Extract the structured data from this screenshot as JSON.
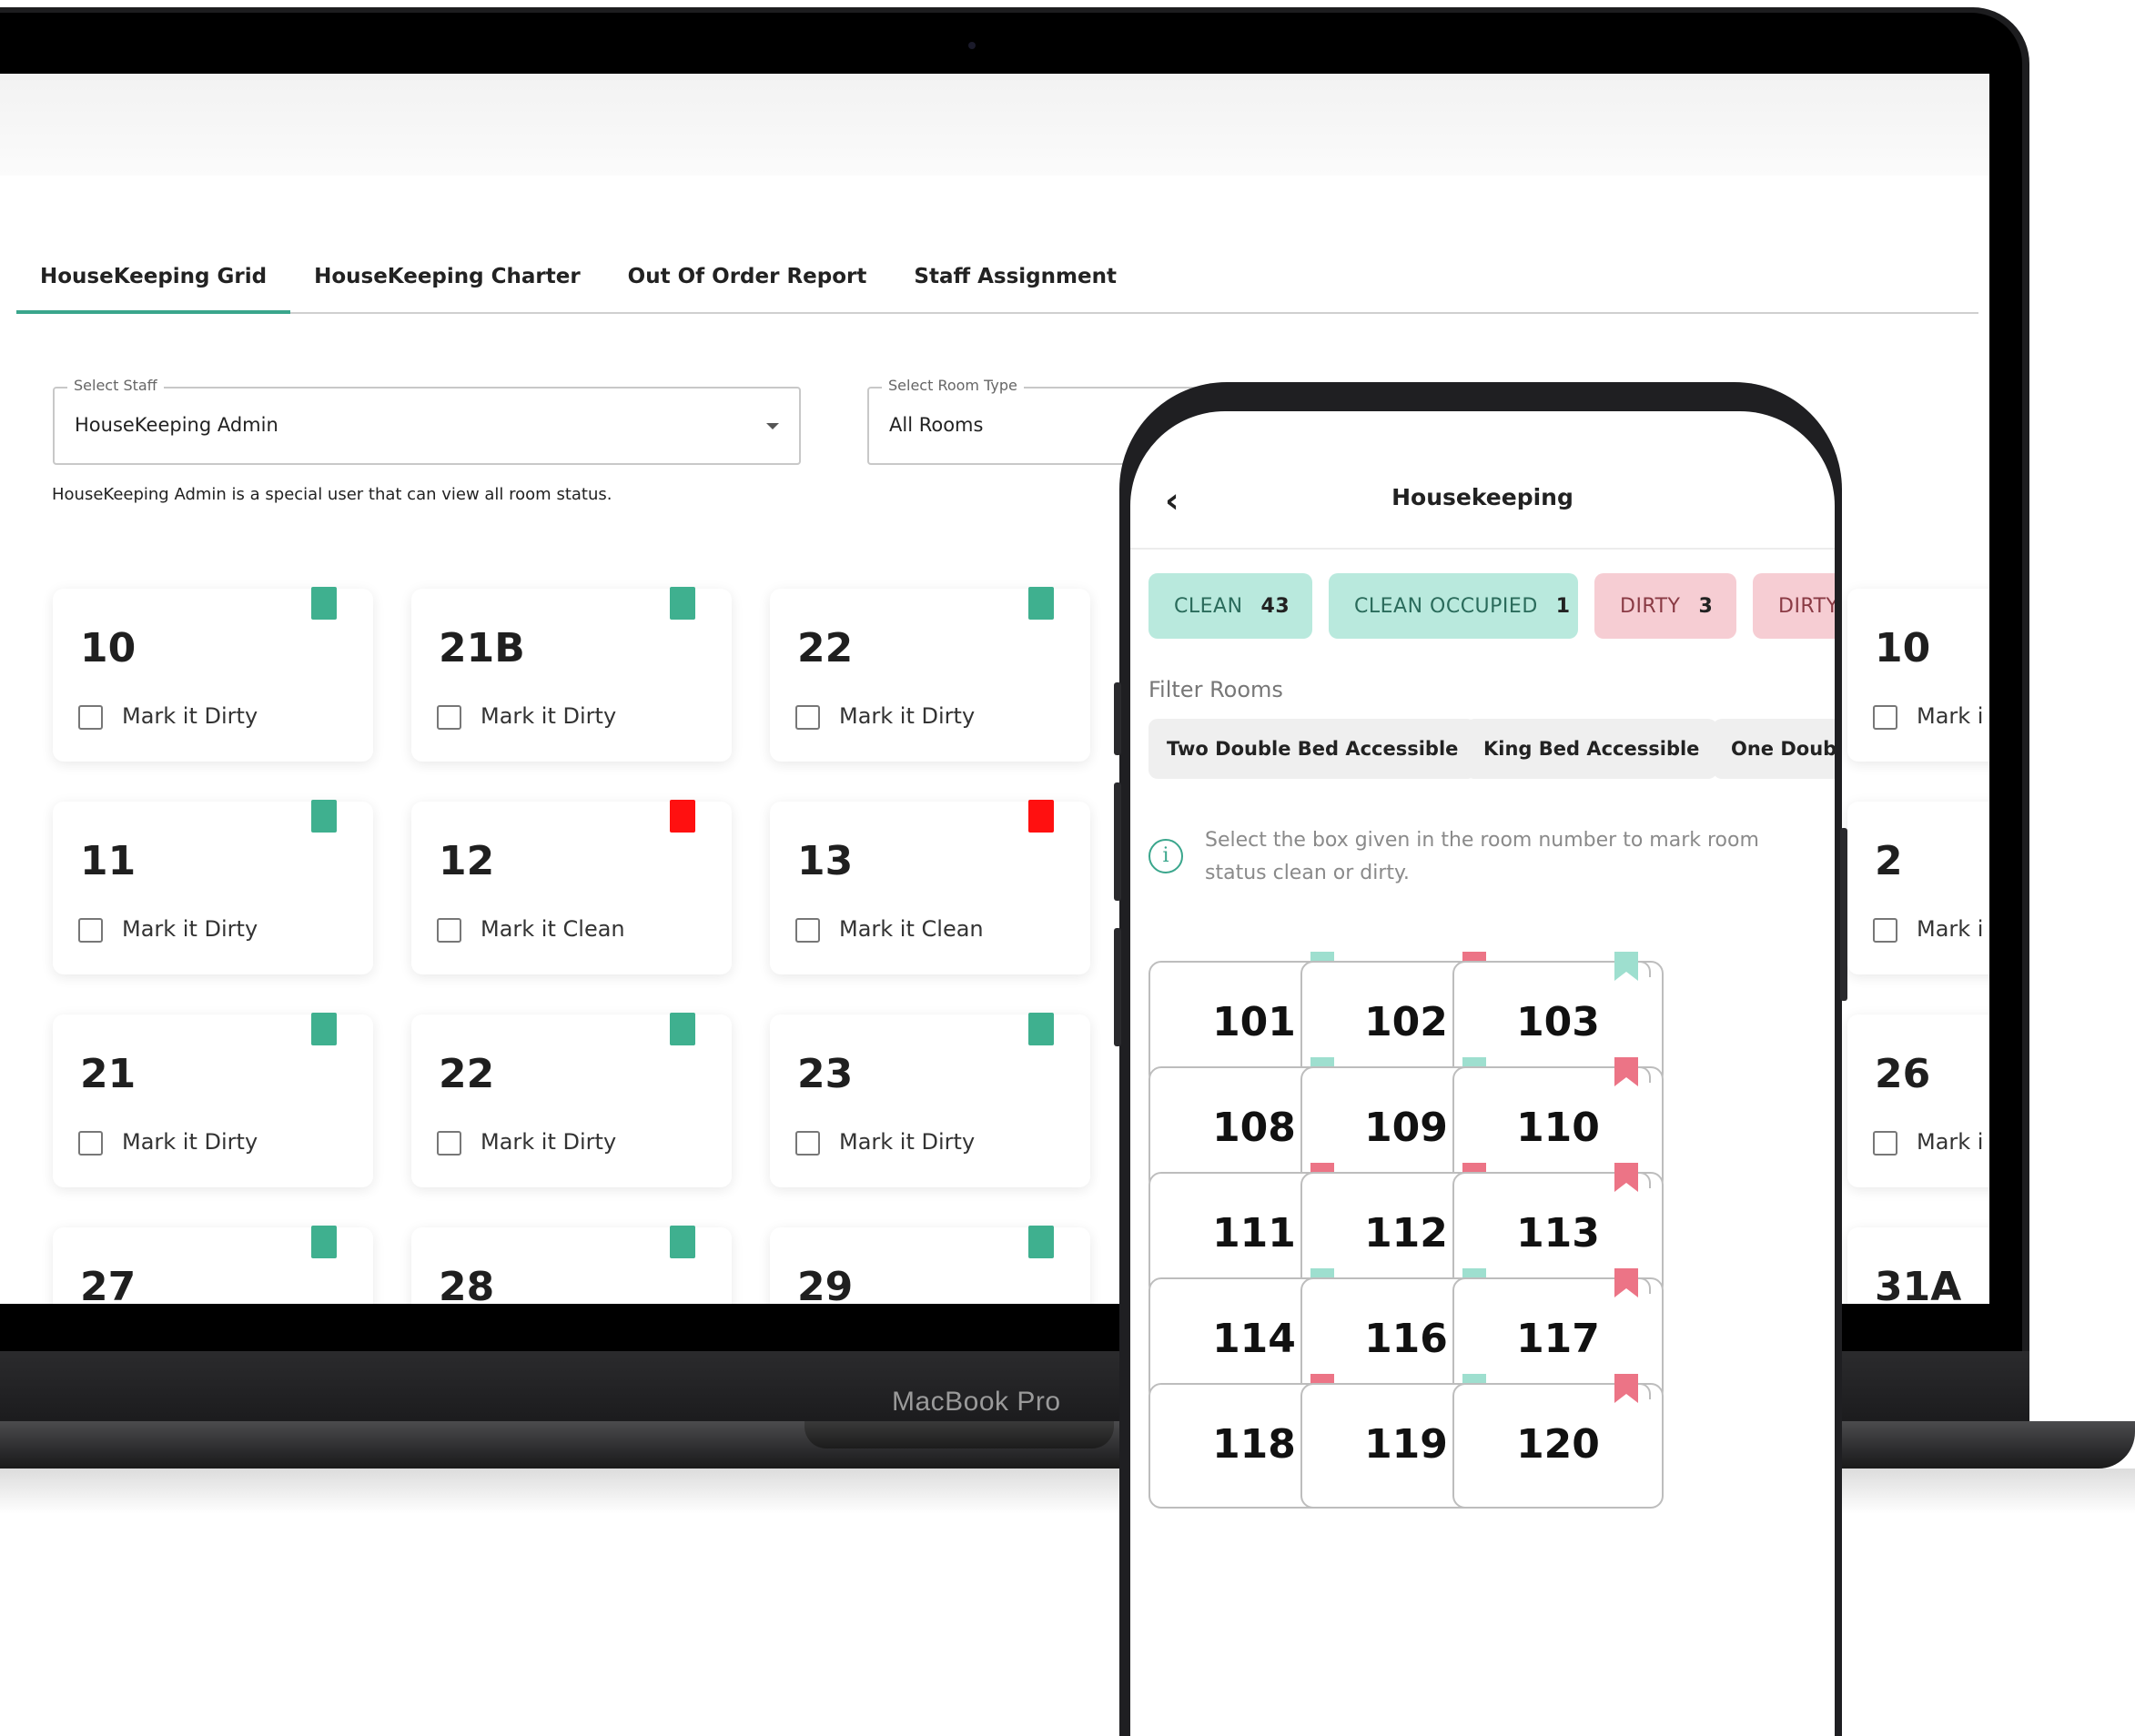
{
  "laptop": {
    "brand": "MacBook Pro"
  },
  "web": {
    "tabs": [
      {
        "label": "HouseKeeping Grid"
      },
      {
        "label": "HouseKeeping Charter"
      },
      {
        "label": "Out Of Order Report"
      },
      {
        "label": "Staff Assignment"
      }
    ],
    "active_tab": "HouseKeeping Grid",
    "accent_color": "#3aa68c",
    "staff_select": {
      "label": "Select Staff",
      "value": "HouseKeeping Admin"
    },
    "room_type_select": {
      "label": "Select Room Type",
      "value": "All Rooms"
    },
    "helper_text": "HouseKeeping Admin is a special user that can view all room status.",
    "rooms": [
      {
        "number": "10",
        "action": "Mark it Dirty",
        "status": "clean"
      },
      {
        "number": "21B",
        "action": "Mark it Dirty",
        "status": "clean"
      },
      {
        "number": "22",
        "action": "Mark it Dirty",
        "status": "clean"
      },
      {
        "number": "10",
        "action": "Mark i",
        "status": "clean"
      },
      {
        "number": "11",
        "action": "Mark it Dirty",
        "status": "clean"
      },
      {
        "number": "12",
        "action": "Mark it Clean",
        "status": "dirty"
      },
      {
        "number": "13",
        "action": "Mark it Clean",
        "status": "dirty"
      },
      {
        "number": "2",
        "action": "Mark i",
        "status": "clean"
      },
      {
        "number": "21",
        "action": "Mark it Dirty",
        "status": "clean"
      },
      {
        "number": "22",
        "action": "Mark it Dirty",
        "status": "clean"
      },
      {
        "number": "23",
        "action": "Mark it Dirty",
        "status": "clean"
      },
      {
        "number": "26",
        "action": "Mark i",
        "status": "clean"
      },
      {
        "number": "27",
        "action": "",
        "status": "clean"
      },
      {
        "number": "28",
        "action": "",
        "status": "clean"
      },
      {
        "number": "29",
        "action": "",
        "status": "clean"
      },
      {
        "number": "31A",
        "action": "",
        "status": "clean"
      }
    ],
    "status_colors": {
      "clean": "#3fb08f",
      "dirty": "#ff1010"
    }
  },
  "phone": {
    "back_icon": "chevron-left-icon",
    "title": "Housekeeping",
    "status_chips": [
      {
        "label": "CLEAN",
        "count": "43",
        "kind": "clean"
      },
      {
        "label": "CLEAN OCCUPIED",
        "count": "1",
        "kind": "clean"
      },
      {
        "label": "DIRTY",
        "count": "3",
        "kind": "dirty"
      },
      {
        "label": "DIRTY",
        "count": "",
        "kind": "dirty"
      }
    ],
    "filter_label": "Filter Rooms",
    "filters": [
      "Two Double Bed Accessible",
      "King Bed Accessible",
      "One Double"
    ],
    "info_text": "Select the box given in the room number to mark room status clean or dirty.",
    "rooms": [
      {
        "number": "101",
        "status": "clean"
      },
      {
        "number": "102",
        "status": "dirty"
      },
      {
        "number": "103",
        "status": "clean"
      },
      {
        "number": "108",
        "status": "clean"
      },
      {
        "number": "109",
        "status": "clean"
      },
      {
        "number": "110",
        "status": "dirty"
      },
      {
        "number": "111",
        "status": "dirty"
      },
      {
        "number": "112",
        "status": "dirty"
      },
      {
        "number": "113",
        "status": "dirty"
      },
      {
        "number": "114",
        "status": "clean"
      },
      {
        "number": "116",
        "status": "clean"
      },
      {
        "number": "117",
        "status": "dirty"
      },
      {
        "number": "118",
        "status": "dirty"
      },
      {
        "number": "119",
        "status": "clean"
      },
      {
        "number": "120",
        "status": "dirty"
      }
    ],
    "bookmark_colors": {
      "clean": "#9edfcf",
      "dirty": "#ec7486"
    }
  }
}
